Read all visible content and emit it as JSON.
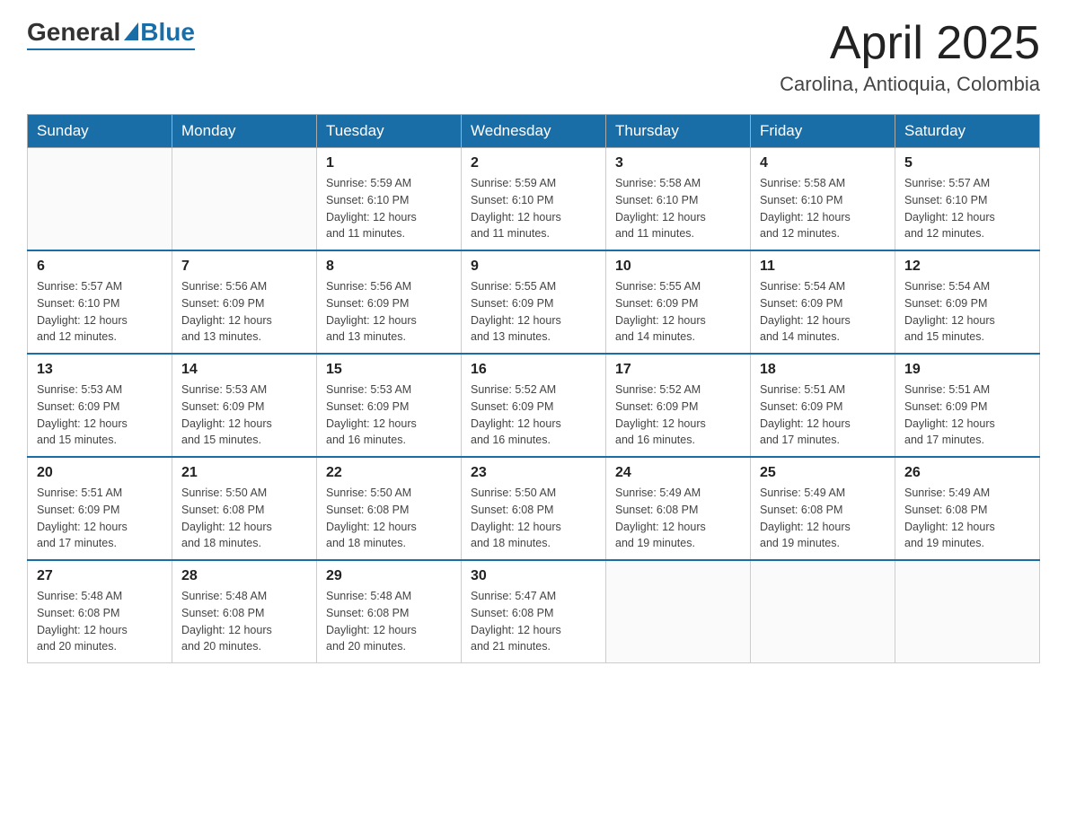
{
  "logo": {
    "general": "General",
    "blue": "Blue"
  },
  "title": "April 2025",
  "subtitle": "Carolina, Antioquia, Colombia",
  "days_of_week": [
    "Sunday",
    "Monday",
    "Tuesday",
    "Wednesday",
    "Thursday",
    "Friday",
    "Saturday"
  ],
  "weeks": [
    [
      {
        "day": "",
        "info": ""
      },
      {
        "day": "",
        "info": ""
      },
      {
        "day": "1",
        "info": "Sunrise: 5:59 AM\nSunset: 6:10 PM\nDaylight: 12 hours\nand 11 minutes."
      },
      {
        "day": "2",
        "info": "Sunrise: 5:59 AM\nSunset: 6:10 PM\nDaylight: 12 hours\nand 11 minutes."
      },
      {
        "day": "3",
        "info": "Sunrise: 5:58 AM\nSunset: 6:10 PM\nDaylight: 12 hours\nand 11 minutes."
      },
      {
        "day": "4",
        "info": "Sunrise: 5:58 AM\nSunset: 6:10 PM\nDaylight: 12 hours\nand 12 minutes."
      },
      {
        "day": "5",
        "info": "Sunrise: 5:57 AM\nSunset: 6:10 PM\nDaylight: 12 hours\nand 12 minutes."
      }
    ],
    [
      {
        "day": "6",
        "info": "Sunrise: 5:57 AM\nSunset: 6:10 PM\nDaylight: 12 hours\nand 12 minutes."
      },
      {
        "day": "7",
        "info": "Sunrise: 5:56 AM\nSunset: 6:09 PM\nDaylight: 12 hours\nand 13 minutes."
      },
      {
        "day": "8",
        "info": "Sunrise: 5:56 AM\nSunset: 6:09 PM\nDaylight: 12 hours\nand 13 minutes."
      },
      {
        "day": "9",
        "info": "Sunrise: 5:55 AM\nSunset: 6:09 PM\nDaylight: 12 hours\nand 13 minutes."
      },
      {
        "day": "10",
        "info": "Sunrise: 5:55 AM\nSunset: 6:09 PM\nDaylight: 12 hours\nand 14 minutes."
      },
      {
        "day": "11",
        "info": "Sunrise: 5:54 AM\nSunset: 6:09 PM\nDaylight: 12 hours\nand 14 minutes."
      },
      {
        "day": "12",
        "info": "Sunrise: 5:54 AM\nSunset: 6:09 PM\nDaylight: 12 hours\nand 15 minutes."
      }
    ],
    [
      {
        "day": "13",
        "info": "Sunrise: 5:53 AM\nSunset: 6:09 PM\nDaylight: 12 hours\nand 15 minutes."
      },
      {
        "day": "14",
        "info": "Sunrise: 5:53 AM\nSunset: 6:09 PM\nDaylight: 12 hours\nand 15 minutes."
      },
      {
        "day": "15",
        "info": "Sunrise: 5:53 AM\nSunset: 6:09 PM\nDaylight: 12 hours\nand 16 minutes."
      },
      {
        "day": "16",
        "info": "Sunrise: 5:52 AM\nSunset: 6:09 PM\nDaylight: 12 hours\nand 16 minutes."
      },
      {
        "day": "17",
        "info": "Sunrise: 5:52 AM\nSunset: 6:09 PM\nDaylight: 12 hours\nand 16 minutes."
      },
      {
        "day": "18",
        "info": "Sunrise: 5:51 AM\nSunset: 6:09 PM\nDaylight: 12 hours\nand 17 minutes."
      },
      {
        "day": "19",
        "info": "Sunrise: 5:51 AM\nSunset: 6:09 PM\nDaylight: 12 hours\nand 17 minutes."
      }
    ],
    [
      {
        "day": "20",
        "info": "Sunrise: 5:51 AM\nSunset: 6:09 PM\nDaylight: 12 hours\nand 17 minutes."
      },
      {
        "day": "21",
        "info": "Sunrise: 5:50 AM\nSunset: 6:08 PM\nDaylight: 12 hours\nand 18 minutes."
      },
      {
        "day": "22",
        "info": "Sunrise: 5:50 AM\nSunset: 6:08 PM\nDaylight: 12 hours\nand 18 minutes."
      },
      {
        "day": "23",
        "info": "Sunrise: 5:50 AM\nSunset: 6:08 PM\nDaylight: 12 hours\nand 18 minutes."
      },
      {
        "day": "24",
        "info": "Sunrise: 5:49 AM\nSunset: 6:08 PM\nDaylight: 12 hours\nand 19 minutes."
      },
      {
        "day": "25",
        "info": "Sunrise: 5:49 AM\nSunset: 6:08 PM\nDaylight: 12 hours\nand 19 minutes."
      },
      {
        "day": "26",
        "info": "Sunrise: 5:49 AM\nSunset: 6:08 PM\nDaylight: 12 hours\nand 19 minutes."
      }
    ],
    [
      {
        "day": "27",
        "info": "Sunrise: 5:48 AM\nSunset: 6:08 PM\nDaylight: 12 hours\nand 20 minutes."
      },
      {
        "day": "28",
        "info": "Sunrise: 5:48 AM\nSunset: 6:08 PM\nDaylight: 12 hours\nand 20 minutes."
      },
      {
        "day": "29",
        "info": "Sunrise: 5:48 AM\nSunset: 6:08 PM\nDaylight: 12 hours\nand 20 minutes."
      },
      {
        "day": "30",
        "info": "Sunrise: 5:47 AM\nSunset: 6:08 PM\nDaylight: 12 hours\nand 21 minutes."
      },
      {
        "day": "",
        "info": ""
      },
      {
        "day": "",
        "info": ""
      },
      {
        "day": "",
        "info": ""
      }
    ]
  ]
}
